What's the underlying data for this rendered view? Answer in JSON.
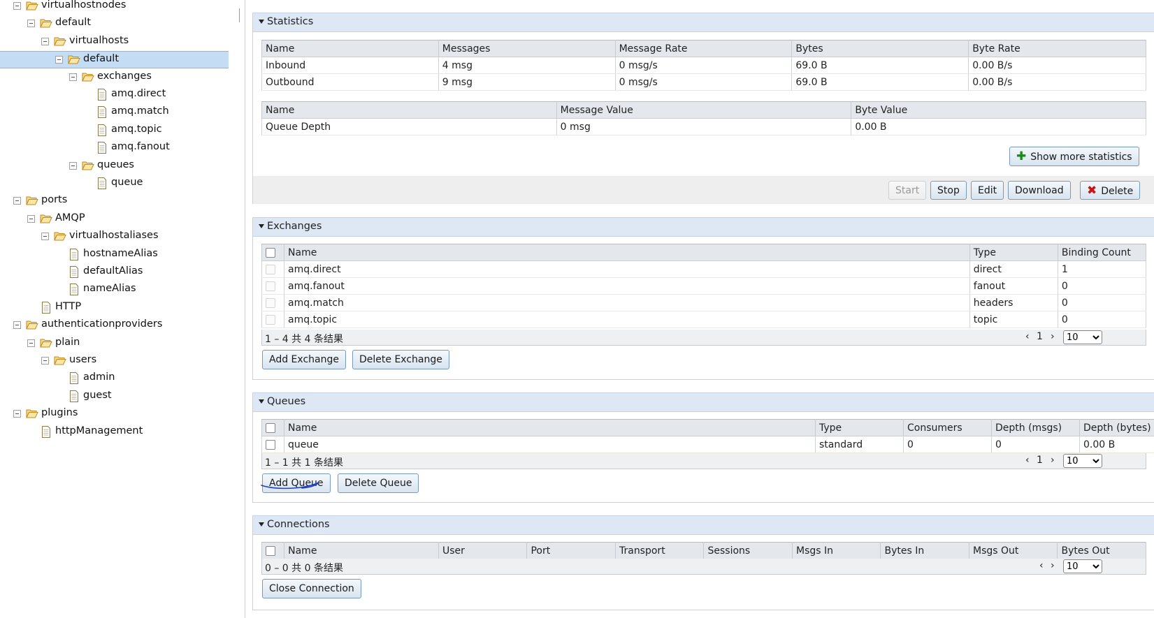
{
  "tree": {
    "items": [
      {
        "label": "virtualhostnodes",
        "icon": "folder-open-icon"
      },
      {
        "label": "default",
        "icon": "folder-open-icon"
      },
      {
        "label": "virtualhosts",
        "icon": "folder-open-icon"
      },
      {
        "label": "default",
        "icon": "folder-open-icon"
      },
      {
        "label": "exchanges",
        "icon": "folder-open-icon"
      },
      {
        "label": "amq.direct",
        "icon": "document-icon"
      },
      {
        "label": "amq.match",
        "icon": "document-icon"
      },
      {
        "label": "amq.topic",
        "icon": "document-icon"
      },
      {
        "label": "amq.fanout",
        "icon": "document-icon"
      },
      {
        "label": "queues",
        "icon": "folder-open-icon"
      },
      {
        "label": "queue",
        "icon": "document-icon"
      },
      {
        "label": "ports",
        "icon": "folder-open-icon"
      },
      {
        "label": "AMQP",
        "icon": "folder-open-icon"
      },
      {
        "label": "virtualhostaliases",
        "icon": "folder-open-icon"
      },
      {
        "label": "hostnameAlias",
        "icon": "document-icon"
      },
      {
        "label": "defaultAlias",
        "icon": "document-icon"
      },
      {
        "label": "nameAlias",
        "icon": "document-icon"
      },
      {
        "label": "HTTP",
        "icon": "document-icon"
      },
      {
        "label": "authenticationproviders",
        "icon": "folder-open-icon"
      },
      {
        "label": "plain",
        "icon": "folder-open-icon"
      },
      {
        "label": "users",
        "icon": "folder-open-icon"
      },
      {
        "label": "admin",
        "icon": "document-icon"
      },
      {
        "label": "guest",
        "icon": "document-icon"
      },
      {
        "label": "plugins",
        "icon": "folder-open-icon"
      },
      {
        "label": "httpManagement",
        "icon": "document-icon"
      }
    ]
  },
  "statistics": {
    "title": "Statistics",
    "rates": {
      "headers": [
        "Name",
        "Messages",
        "Message Rate",
        "Bytes",
        "Byte Rate"
      ],
      "rows": [
        [
          "Inbound",
          "4 msg",
          "0 msg/s",
          "69.0 B",
          "0.00 B/s"
        ],
        [
          "Outbound",
          "9 msg",
          "0 msg/s",
          "69.0 B",
          "0.00 B/s"
        ]
      ]
    },
    "depth": {
      "headers": [
        "Name",
        "Message Value",
        "Byte Value"
      ],
      "rows": [
        [
          "Queue Depth",
          "0 msg",
          "0.00 B"
        ]
      ]
    },
    "show_more_label": "Show more statistics",
    "show_more_icon": "plus-icon"
  },
  "toolbar": {
    "start": "Start",
    "stop": "Stop",
    "edit": "Edit",
    "download": "Download",
    "delete": "Delete",
    "delete_icon": "x-icon"
  },
  "exchanges": {
    "title": "Exchanges",
    "headers": [
      "Name",
      "Type",
      "Binding Count"
    ],
    "rows": [
      [
        "amq.direct",
        "direct",
        "1"
      ],
      [
        "amq.fanout",
        "fanout",
        "0"
      ],
      [
        "amq.match",
        "headers",
        "0"
      ],
      [
        "amq.topic",
        "topic",
        "0"
      ]
    ],
    "count_text": "1 – 4 共 4 条结果",
    "page": "1",
    "page_size": "10",
    "add_label": "Add Exchange",
    "delete_label": "Delete Exchange"
  },
  "queues": {
    "title": "Queues",
    "headers": [
      "Name",
      "Type",
      "Consumers",
      "Depth (msgs)",
      "Depth (bytes)"
    ],
    "rows": [
      [
        "queue",
        "standard",
        "0",
        "0",
        "0.00 B"
      ]
    ],
    "count_text": "1 – 1 共 1 条结果",
    "page": "1",
    "page_size": "10",
    "add_label": "Add Queue",
    "delete_label": "Delete Queue"
  },
  "connections": {
    "title": "Connections",
    "headers": [
      "Name",
      "User",
      "Port",
      "Transport",
      "Sessions",
      "Msgs In",
      "Bytes In",
      "Msgs Out",
      "Bytes Out"
    ],
    "count_text": "0 – 0 共 0 条结果",
    "page_size": "10",
    "close_label": "Close Connection"
  },
  "colors": {
    "panel_header": "#dde8f4",
    "selection": "#c5ddf4",
    "annotation_ink": "#1f3fbf"
  }
}
